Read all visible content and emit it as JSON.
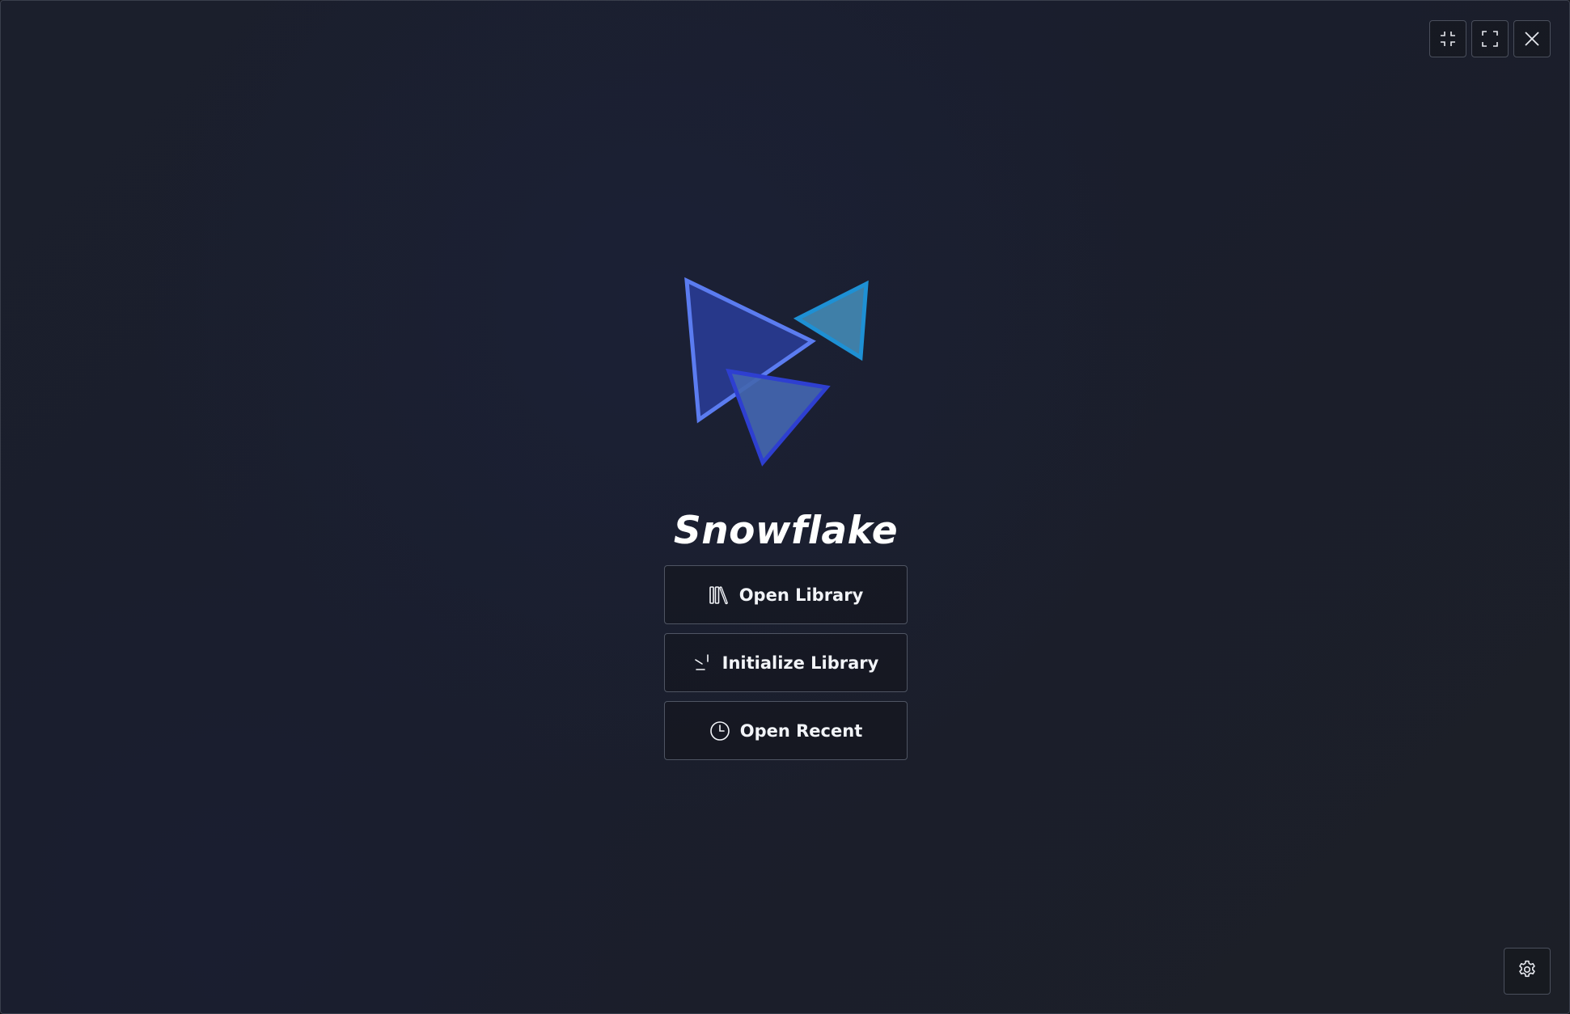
{
  "window": {
    "controls": {
      "compact": "compact-icon",
      "fullscreen": "fullscreen-icon",
      "close": "close-icon"
    }
  },
  "app": {
    "name": "Snowflake",
    "logo": "snowflake-triangles-logo"
  },
  "actions": [
    {
      "label": "Open Library",
      "icon": "library-books-icon"
    },
    {
      "label": "Initialize Library",
      "icon": "sparkle-init-icon"
    },
    {
      "label": "Open Recent",
      "icon": "clock-icon"
    }
  ],
  "settings": {
    "icon": "gear-icon"
  },
  "colors": {
    "background": "#1b1f2c",
    "logo_blue_stroke": "#5b7cf0",
    "logo_blue_fill": "#27388a",
    "logo_cyan_stroke": "#1e90d4",
    "logo_cyan_fill": "#3f7fa8",
    "logo_indigo_stroke": "#2e3fd0",
    "logo_indigo_fill": "#4366b0",
    "text": "#ffffff",
    "border": "#4f5563"
  }
}
